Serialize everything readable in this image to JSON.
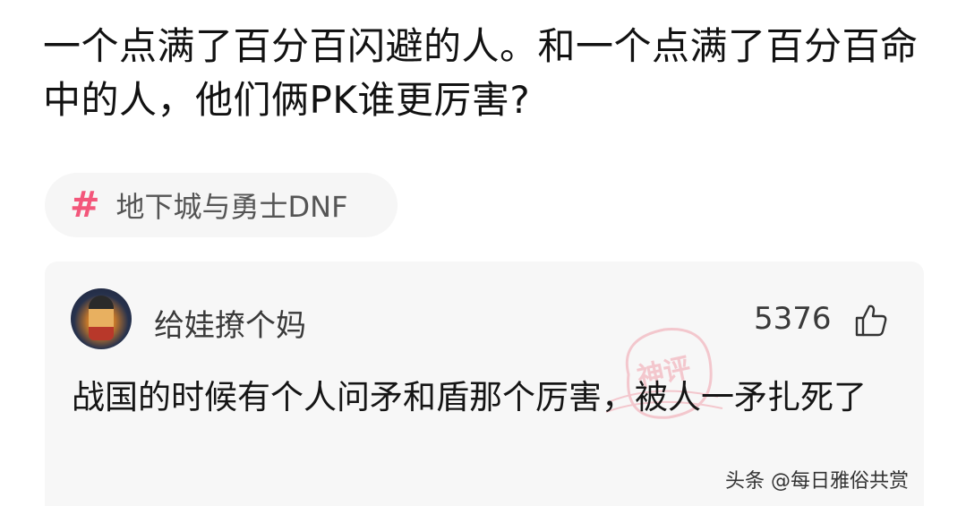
{
  "question": {
    "title": "一个点满了百分百闪避的人。和一个点满了百分百命中的人，他们俩PK谁更厉害?"
  },
  "topic": {
    "hash_symbol": "#",
    "label": "地下城与勇士DNF",
    "accent_color": "#f3577b"
  },
  "comment": {
    "username": "给娃撩个妈",
    "like_count": "5376",
    "like_icon": "thumbs-up-icon",
    "text": "战国的时候有个人问矛和盾那个厉害，被人一矛扎死了",
    "badge_text": "神评",
    "badge_color": "#f0a0ac"
  },
  "watermark": {
    "text": "头条 @每日雅俗共赏"
  }
}
